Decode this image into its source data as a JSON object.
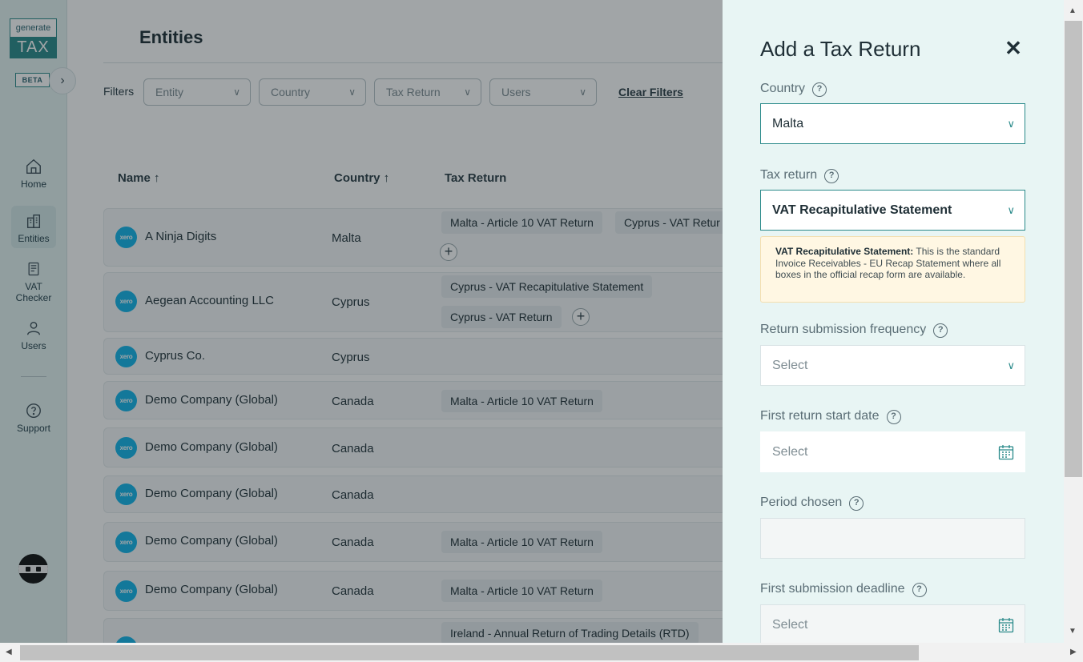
{
  "sidebar": {
    "logo_top": "generate",
    "logo_bottom": "TAX",
    "beta": "BETA",
    "nav": [
      {
        "label": "Home"
      },
      {
        "label": "Entities"
      },
      {
        "label": "VAT Checker"
      },
      {
        "label": "Users"
      },
      {
        "label": "Support"
      }
    ]
  },
  "main": {
    "title": "Entities",
    "filters_label": "Filters",
    "filters": [
      "Entity",
      "Country",
      "Tax Return",
      "Users"
    ],
    "clear_filters": "Clear Filters",
    "columns": {
      "name": "Name",
      "country": "Country",
      "tax_return": "Tax Return"
    },
    "rows": [
      {
        "name": "A Ninja Digits",
        "country": "Malta",
        "returns": [
          "Malta - Article 10 VAT Return",
          "Cyprus - VAT Retur"
        ]
      },
      {
        "name": "Aegean Accounting LLC",
        "country": "Cyprus",
        "returns": [
          "Cyprus - VAT Recapitulative Statement",
          "Cyprus - VAT Return"
        ]
      },
      {
        "name": "Cyprus Co.",
        "country": "Cyprus",
        "returns": []
      },
      {
        "name": "Demo Company (Global)",
        "country": "Canada",
        "returns": [
          "Malta - Article 10 VAT Return"
        ]
      },
      {
        "name": "Demo Company (Global)",
        "country": "Canada",
        "returns": []
      },
      {
        "name": "Demo Company (Global)",
        "country": "Canada",
        "returns": []
      },
      {
        "name": "Demo Company (Global)",
        "country": "Canada",
        "returns": [
          "Malta - Article 10 VAT Return"
        ]
      },
      {
        "name": "Demo Company (Global)",
        "country": "Canada",
        "returns": [
          "Malta - Article 10 VAT Return"
        ]
      },
      {
        "name": "",
        "country": "",
        "returns": [
          "Ireland - Annual Return of Trading Details (RTD)"
        ]
      }
    ],
    "xero_badge": "xero"
  },
  "panel": {
    "title": "Add a Tax Return",
    "country_label": "Country",
    "country_value": "Malta",
    "tax_return_label": "Tax return",
    "tax_return_value": "VAT Recapitulative Statement",
    "info_title": "VAT Recapitulative Statement:",
    "info_text": " This is the standard Invoice Receivables - EU Recap Statement where all boxes in the official recap form are available.",
    "frequency_label": "Return submission frequency",
    "frequency_placeholder": "Select",
    "start_date_label": "First return start date",
    "start_date_placeholder": "Select",
    "period_label": "Period chosen",
    "period_value": "",
    "deadline_label": "First submission deadline",
    "deadline_placeholder": "Select"
  },
  "colors": {
    "accent": "#2a8a8a",
    "xero": "#13b5ea",
    "panel_bg": "#e8f5f4",
    "info_bg": "#fff7e3"
  }
}
